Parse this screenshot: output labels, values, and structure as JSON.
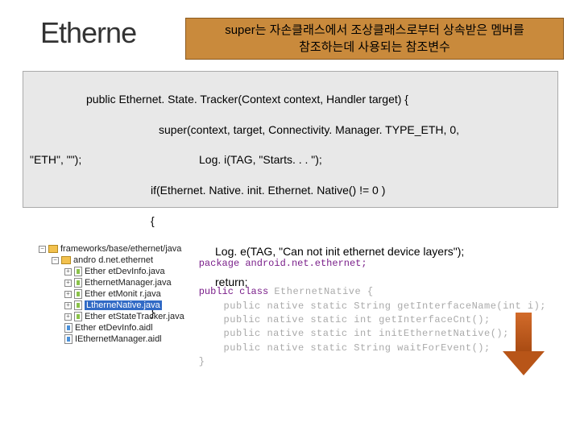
{
  "title": "Etherne",
  "callout": {
    "line1": "super는 자손클래스에서 조상클래스로부터 상속받은 멤버를",
    "line2": "참조하는데 사용되는 참조변수"
  },
  "code": {
    "l1": "public Ethernet. State. Tracker(Context context, Handler target) {",
    "l2": "super(context, target, Connectivity. Manager. TYPE_ETH, 0,",
    "l3_left": "\"ETH\", \"\");",
    "l3_right": "Log. i(TAG, \"Starts. . . \");",
    "l4": "if(Ethernet. Native. init. Ethernet. Native() != 0 )",
    "l5": "{",
    "l6": "Log. e(TAG, \"Can not init ethernet device layers\");",
    "l7": "return;",
    "l8": "}"
  },
  "tree": {
    "root": "frameworks/base/ethernet/java",
    "pkg": "andro d.net.ethernet",
    "files": [
      "Ether etDevInfo.java",
      "EthernetManager.java",
      "Ether etMonit r.java",
      "LtherneNative.java",
      "Ether etStateTracker.java",
      "Ether etDevInfo.aidl",
      "IEthernetManager.aidl"
    ],
    "selected_index": 3
  },
  "rightcode": {
    "r1_a": "package",
    "r1_b": " android.net.ethernet;",
    "r2_a": "public class ",
    "r2_b": "EthernetNative {",
    "r3": "    public native static String getInterfaceName(int i);",
    "r4": "    public native static int getInterfaceCnt();",
    "r5": "    public native static int initEthernetNative();",
    "r6": "    public native static String waitForEvent();",
    "r7": "}"
  }
}
